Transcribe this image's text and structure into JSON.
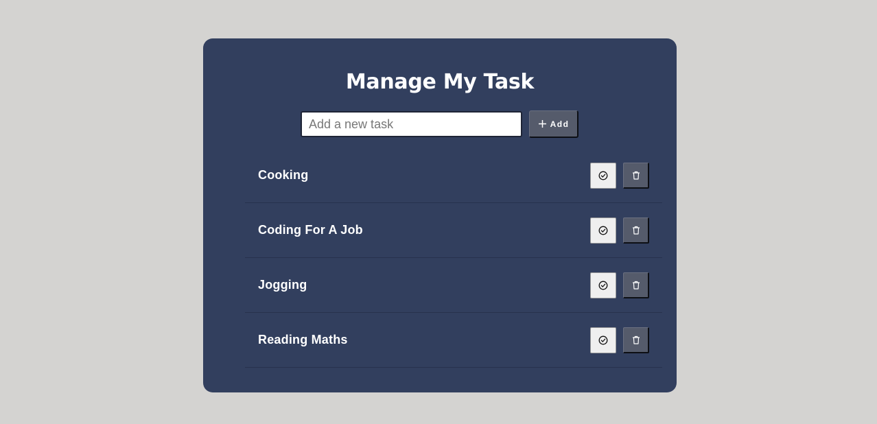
{
  "app": {
    "title": "Manage My Task"
  },
  "new_task": {
    "placeholder": "Add a new task",
    "value": "",
    "add_label": "Add",
    "add_icon": "plus-icon"
  },
  "tasks": [
    {
      "label": "Cooking",
      "done_icon": "check-circle-icon",
      "delete_icon": "trash-icon"
    },
    {
      "label": "Coding For A Job",
      "done_icon": "check-circle-icon",
      "delete_icon": "trash-icon"
    },
    {
      "label": "Jogging",
      "done_icon": "check-circle-icon",
      "delete_icon": "trash-icon"
    },
    {
      "label": "Reading Maths",
      "done_icon": "check-circle-icon",
      "delete_icon": "trash-icon"
    }
  ],
  "colors": {
    "page_background": "#d4d3d1",
    "card_background": "#323f5e",
    "button_dark": "#555b6b",
    "button_light": "#efefef",
    "text": "#ffffff"
  }
}
